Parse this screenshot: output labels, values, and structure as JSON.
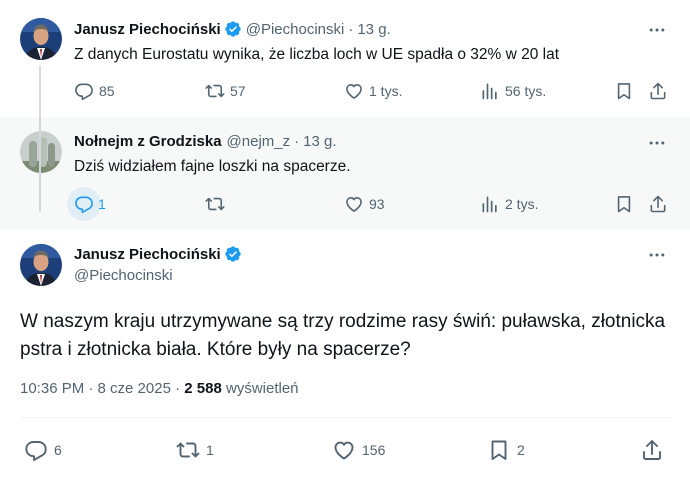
{
  "colors": {
    "text": "#0f1419",
    "secondary": "#536471",
    "verified": "#1d9bf0",
    "reply_highlight": "#e1eef6",
    "alt_bg": "#f7f9f9"
  },
  "tweet1": {
    "name": "Janusz Piechociński",
    "handle": "@Piechocinski",
    "time": "13 g.",
    "text": "Z danych Eurostatu wynika, że liczba loch w UE spadła o 32% w 20 lat",
    "replies": "85",
    "retweets": "57",
    "likes": "1 tys.",
    "views": "56 tys."
  },
  "tweet2": {
    "name": "Nołnejm z Grodziska",
    "handle": "@nejm_z",
    "time": "13 g.",
    "text": "Dziś widziałem fajne loszki na spacerze.",
    "replies": "1",
    "retweets": "",
    "likes": "93",
    "views": "2 tys."
  },
  "tweet3": {
    "name": "Janusz Piechociński",
    "handle": "@Piechocinski",
    "text": "W naszym kraju utrzymywane są trzy rodzime rasy świń: puławska, złotnicka pstra i złotnicka biała. Które były na spacerze?",
    "timestamp": "10:36 PM · 8 cze 2025 ·",
    "views_count": "2 588",
    "views_label": "wyświetleń",
    "replies": "6",
    "retweets": "1",
    "likes": "156",
    "bookmarks": "2"
  },
  "icons": [
    "verified-badge-icon",
    "more-icon",
    "reply-icon",
    "retweet-icon",
    "like-icon",
    "views-icon",
    "bookmark-icon",
    "share-icon"
  ]
}
